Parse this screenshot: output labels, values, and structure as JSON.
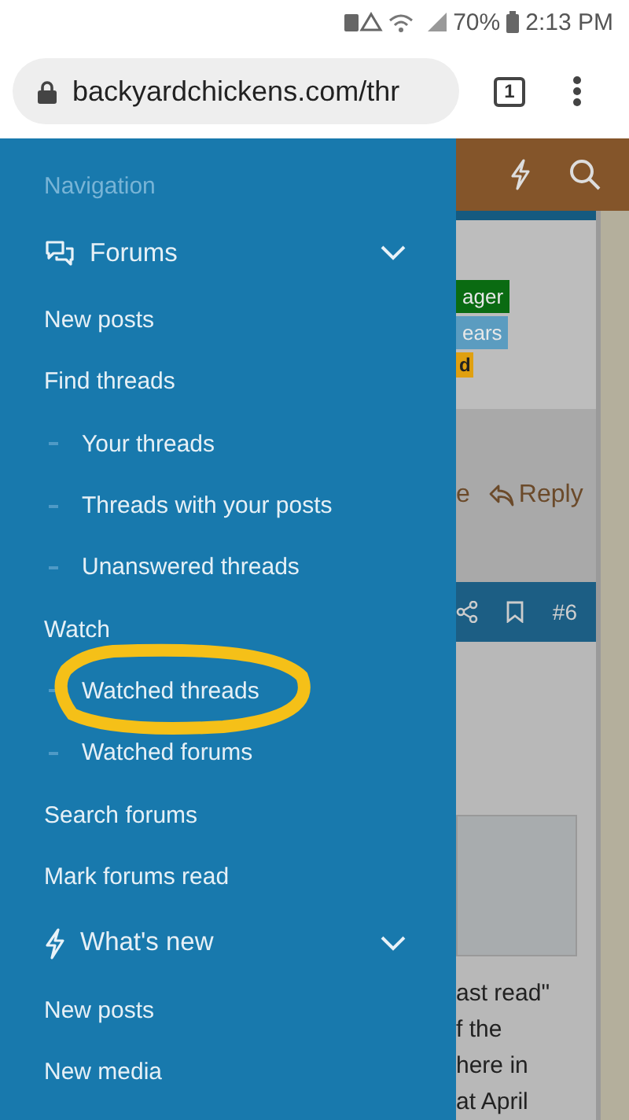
{
  "status_bar": {
    "battery": "70%",
    "time": "2:13 PM"
  },
  "browser": {
    "url": "backyardchickens.com/thr",
    "tab_count": "1"
  },
  "drawer": {
    "heading": "Navigation",
    "items": [
      {
        "kind": "section",
        "label": "Forums",
        "expanded": true
      },
      {
        "kind": "link",
        "label": "New posts"
      },
      {
        "kind": "link",
        "label": "Find threads"
      },
      {
        "kind": "sub",
        "label": "Your threads"
      },
      {
        "kind": "sub",
        "label": "Threads with your posts"
      },
      {
        "kind": "sub",
        "label": "Unanswered threads"
      },
      {
        "kind": "link",
        "label": "Watch"
      },
      {
        "kind": "sub",
        "label": "Watched threads",
        "circled": true
      },
      {
        "kind": "sub",
        "label": "Watched forums"
      },
      {
        "kind": "link",
        "label": "Search forums"
      },
      {
        "kind": "link",
        "label": "Mark forums read"
      },
      {
        "kind": "section",
        "label": "What's new",
        "expanded": true
      },
      {
        "kind": "link",
        "label": "New posts"
      },
      {
        "kind": "link",
        "label": "New media"
      }
    ]
  },
  "page": {
    "badges": [
      {
        "label": "ager",
        "color": "#0a6b12"
      },
      {
        "label": "ears",
        "color": "#5b9cc0"
      },
      {
        "label": "d",
        "color": "#e0a010"
      }
    ],
    "action_fragment": "e",
    "reply": "Reply",
    "post_number": "#6",
    "text_lines": [
      "ast read\"",
      "f the",
      "here in",
      "at April"
    ]
  }
}
